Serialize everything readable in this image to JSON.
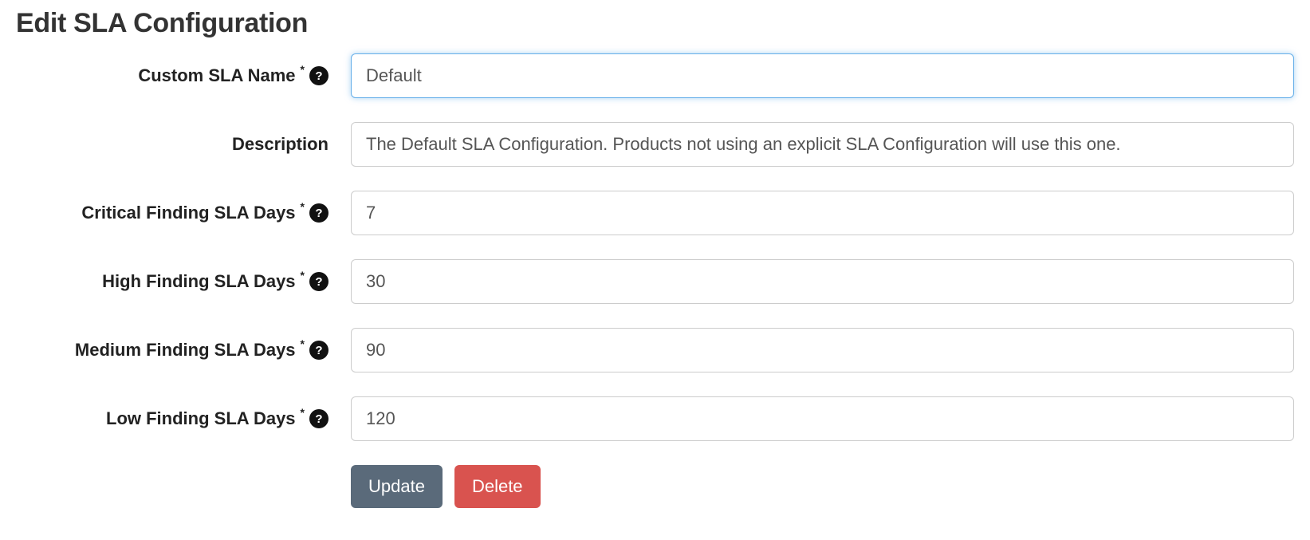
{
  "page": {
    "title": "Edit SLA Configuration"
  },
  "form": {
    "fields": {
      "name": {
        "label": "Custom SLA Name",
        "required": true,
        "help": true,
        "value": "Default"
      },
      "description": {
        "label": "Description",
        "required": false,
        "help": false,
        "value": "The Default SLA Configuration. Products not using an explicit SLA Configuration will use this one."
      },
      "critical": {
        "label": "Critical Finding SLA Days",
        "required": true,
        "help": true,
        "value": "7"
      },
      "high": {
        "label": "High Finding SLA Days",
        "required": true,
        "help": true,
        "value": "30"
      },
      "medium": {
        "label": "Medium Finding SLA Days",
        "required": true,
        "help": true,
        "value": "90"
      },
      "low": {
        "label": "Low Finding SLA Days",
        "required": true,
        "help": true,
        "value": "120"
      }
    },
    "actions": {
      "update": "Update",
      "delete": "Delete"
    }
  },
  "icons": {
    "help_glyph": "?",
    "required_glyph": "*"
  }
}
